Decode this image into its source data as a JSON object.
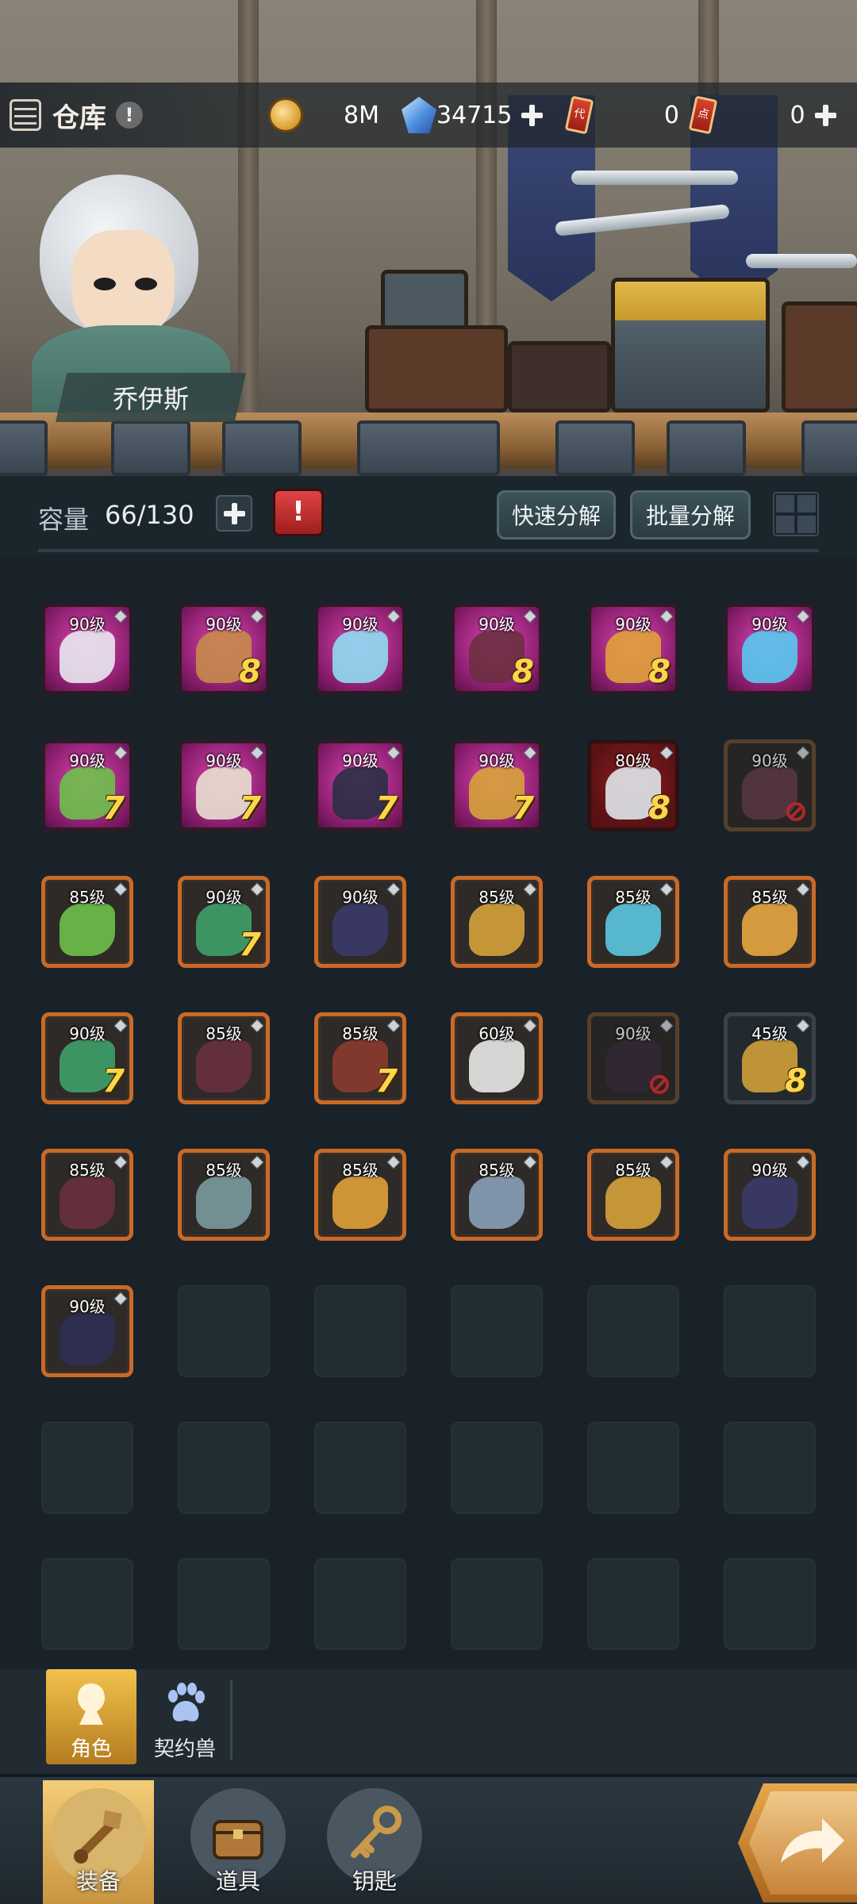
{
  "header": {
    "title": "仓库",
    "info_glyph": "!",
    "character_name": "乔伊斯"
  },
  "resources": {
    "gold": {
      "icon": "gold-coin-icon",
      "value": "8M"
    },
    "gems": {
      "icon": "blue-crystal-icon",
      "value": "34715"
    },
    "voucher": {
      "icon": "red-voucher-icon",
      "glyph": "代",
      "value": "0"
    },
    "points": {
      "icon": "red-points-ticket-icon",
      "glyph": "点",
      "value": "0"
    }
  },
  "capacity": {
    "label": "容量",
    "value": "66/130",
    "bag_glyph": "!"
  },
  "actions": {
    "quick_dismantle": "快速分解",
    "batch_dismantle": "批量分解"
  },
  "items": [
    {
      "level": "90级",
      "quality": "pink",
      "star": "",
      "icon": "dragon-helmet-icon",
      "art": "#e8e8f0"
    },
    {
      "level": "90级",
      "quality": "pink",
      "star": "8",
      "icon": "gauntlet-icon",
      "art": "#c7894a"
    },
    {
      "level": "90级",
      "quality": "pink",
      "star": "",
      "icon": "ice-sword-icon",
      "art": "#8fdcf2"
    },
    {
      "level": "90级",
      "quality": "pink",
      "star": "8",
      "icon": "boots-icon",
      "art": "#6a3040"
    },
    {
      "level": "90级",
      "quality": "pink",
      "star": "8",
      "icon": "feather-blade-icon",
      "art": "#e0a13a"
    },
    {
      "level": "90级",
      "quality": "pink",
      "star": "",
      "icon": "crystal-amulet-icon",
      "art": "#58c9f0"
    },
    {
      "level": "90级",
      "quality": "pink",
      "star": "7",
      "icon": "leaf-helmet-icon",
      "art": "#6ec04b"
    },
    {
      "level": "90级",
      "quality": "pink",
      "star": "7",
      "icon": "skirt-boots-icon",
      "art": "#e8e0d0"
    },
    {
      "level": "90级",
      "quality": "pink",
      "star": "7",
      "icon": "dark-hood-icon",
      "art": "#2a2f45"
    },
    {
      "level": "90级",
      "quality": "pink",
      "star": "7",
      "icon": "gold-armor-icon",
      "art": "#d6a23a"
    },
    {
      "level": "80级",
      "quality": "red",
      "star": "8",
      "icon": "long-sword-icon",
      "art": "#dfe6ea"
    },
    {
      "level": "90级",
      "quality": "dim",
      "star": "",
      "icon": "dark-armor-icon",
      "art": "#6b3d4a",
      "locked_out": true
    },
    {
      "level": "85级",
      "quality": "orange",
      "star": "",
      "icon": "leaf-armor-icon",
      "art": "#6ec04b"
    },
    {
      "level": "90级",
      "quality": "orange",
      "star": "7",
      "icon": "leaf-ring-icon",
      "art": "#3fa06a"
    },
    {
      "level": "90级",
      "quality": "orange",
      "star": "",
      "icon": "shadow-gauntlet-icon",
      "art": "#3a3a6a"
    },
    {
      "level": "85级",
      "quality": "orange",
      "star": "",
      "icon": "gold-armor-icon",
      "art": "#d6a23a"
    },
    {
      "level": "85级",
      "quality": "orange",
      "star": "",
      "icon": "gem-necklace-icon",
      "art": "#5bc6e0"
    },
    {
      "level": "85级",
      "quality": "orange",
      "star": "",
      "icon": "gold-ring-icon",
      "art": "#e8a640"
    },
    {
      "level": "90级",
      "quality": "orange",
      "star": "7",
      "icon": "leaf-necklace-icon",
      "art": "#3fa06a"
    },
    {
      "level": "85级",
      "quality": "orange",
      "star": "",
      "icon": "boots-icon",
      "art": "#6a3040"
    },
    {
      "level": "85级",
      "quality": "orange",
      "star": "7",
      "icon": "beast-pauldron-icon",
      "art": "#8b3a30"
    },
    {
      "level": "60级",
      "quality": "orange",
      "star": "",
      "icon": "white-blade-icon",
      "art": "#e8e8e8"
    },
    {
      "level": "90级",
      "quality": "dim",
      "star": "",
      "icon": "dark-helmet-icon",
      "art": "#3a2a38",
      "locked_out": true
    },
    {
      "level": "45级",
      "quality": "dark",
      "star": "8",
      "icon": "winged-crown-icon",
      "art": "#d0a03a"
    },
    {
      "level": "85级",
      "quality": "orange",
      "star": "",
      "icon": "boots-icon",
      "art": "#6a3040"
    },
    {
      "level": "85级",
      "quality": "orange",
      "star": "",
      "icon": "dagger-icon",
      "art": "#7a9aa0"
    },
    {
      "level": "85级",
      "quality": "orange",
      "star": "",
      "icon": "feather-blade-icon",
      "art": "#e0a13a"
    },
    {
      "level": "85级",
      "quality": "orange",
      "star": "",
      "icon": "gem-gauntlet-icon",
      "art": "#8aa0b8"
    },
    {
      "level": "85级",
      "quality": "orange",
      "star": "",
      "icon": "gold-chest-armor-icon",
      "art": "#d6a23a"
    },
    {
      "level": "90级",
      "quality": "orange",
      "star": "",
      "icon": "shadow-gauntlet-icon",
      "art": "#3a3a6a"
    },
    {
      "level": "90级",
      "quality": "orange",
      "star": "",
      "icon": "dark-pants-icon",
      "art": "#2e2f55"
    }
  ],
  "empty_slots": 17,
  "subtabs": [
    {
      "label": "角色",
      "icon": "character-silhouette-icon",
      "active": true
    },
    {
      "label": "契约兽",
      "icon": "paw-icon",
      "active": false
    }
  ],
  "bottom_nav": [
    {
      "label": "装备",
      "icon": "equipment-icon",
      "active": true
    },
    {
      "label": "道具",
      "icon": "chest-icon",
      "active": false
    },
    {
      "label": "钥匙",
      "icon": "key-icon",
      "active": false
    }
  ],
  "colors": {
    "star": "#ffd54d",
    "quality_pink": "#e44ab6",
    "quality_orange": "#c96a27",
    "active_tab": "#f2c24c"
  }
}
